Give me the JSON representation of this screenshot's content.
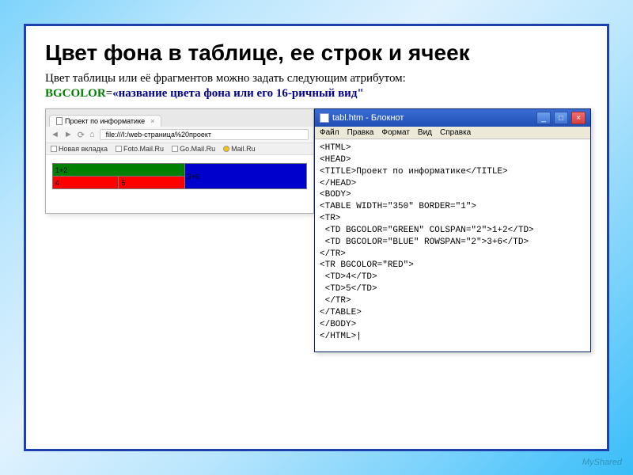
{
  "title": "Цвет фона в таблице, ее строк и ячеек",
  "description": "Цвет таблицы или её фрагментов можно задать следующим атрибутом:",
  "attr": {
    "name": "BGCOLOR",
    "eq": "=",
    "value": "«название цвета фона или его 16-ричный вид\""
  },
  "browser": {
    "tab_title": "Проект по информатике",
    "url_prefix": "file:///I:/web-страница%20проект",
    "bookmarks": [
      "Новая вкладка",
      "Foto.Mail.Ru",
      "Go.Mail.Ru",
      "Mail.Ru"
    ],
    "cells": {
      "green": "1+2",
      "blue": "3+6",
      "red_a": "4",
      "red_b": "5"
    }
  },
  "notepad": {
    "window_title": "tabl.htm - Блокнот",
    "menu": [
      "Файл",
      "Правка",
      "Формат",
      "Вид",
      "Справка"
    ],
    "code": "<HTML>\n<HEAD>\n<TITLE>Проект по информатике</TITLE>\n</HEAD>\n<BODY>\n<TABLE WIDTH=\"350\" BORDER=\"1\">\n<TR>\n <TD BGCOLOR=\"GREEN\" COLSPAN=\"2\">1+2</TD>\n <TD BGCOLOR=\"BLUE\" ROWSPAN=\"2\">3+6</TD>\n</TR>\n<TR BGCOLOR=\"RED\">\n <TD>4</TD>\n <TD>5</TD>\n </TR>\n</TABLE>\n</BODY>\n</HTML>|"
  },
  "watermark": "MyShared"
}
